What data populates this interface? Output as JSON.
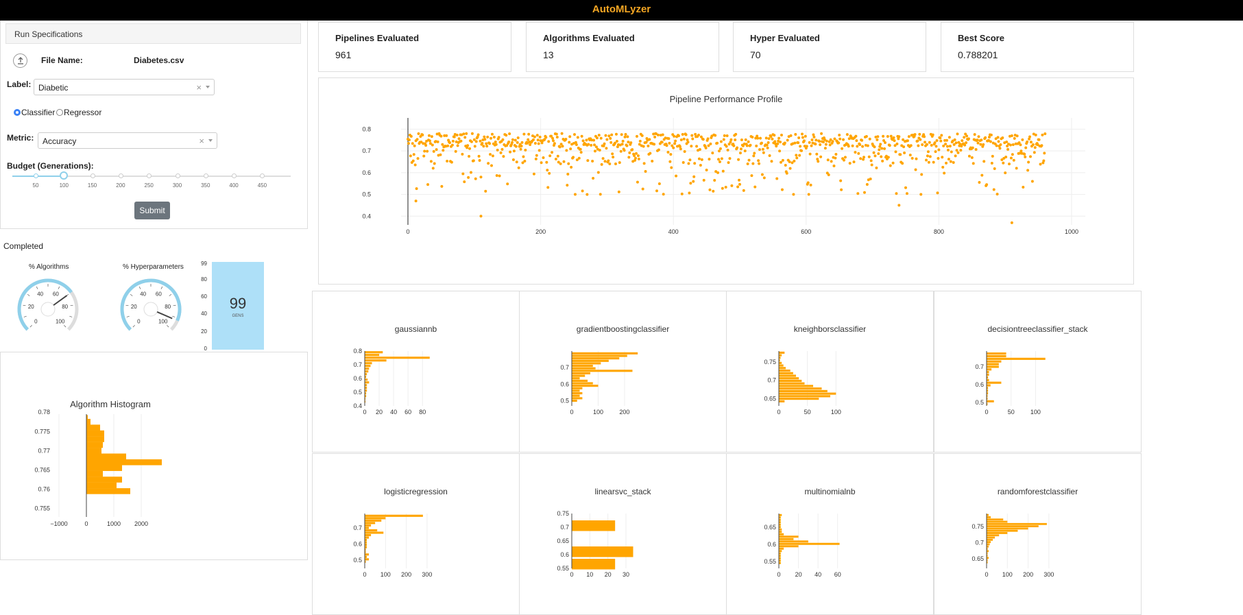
{
  "app": {
    "title": "AutoMLyzer"
  },
  "run_spec": {
    "header": "Run Specifications",
    "file_name_label": "File Name:",
    "file_name": "Diabetes.csv",
    "label_label": "Label:",
    "label_value": "Diabetic",
    "mode_options": [
      "Classifier",
      "Regressor"
    ],
    "mode_selected": "Classifier",
    "metric_label": "Metric:",
    "metric_value": "Accuracy",
    "budget_label": "Budget (Generations):",
    "budget_ticks": [
      "50",
      "100",
      "150",
      "200",
      "250",
      "300",
      "350",
      "400",
      "450"
    ],
    "budget_value": 100,
    "submit_label": "Submit"
  },
  "status": {
    "text": "Completed",
    "algorithms_gauge": {
      "title": "% Algorithms",
      "ticks": [
        "0",
        "20",
        "40",
        "60",
        "80",
        "100"
      ],
      "value": 70
    },
    "hyper_gauge": {
      "title": "% Hyperparameters",
      "ticks": [
        "0",
        "20",
        "40",
        "60",
        "80",
        "100"
      ],
      "value": 92
    },
    "progress": {
      "value": "99",
      "unit": "GENS",
      "axis": [
        "99",
        "80",
        "60",
        "40",
        "20",
        "0"
      ],
      "fill_fraction": 1.0
    }
  },
  "kpis": [
    {
      "title": "Pipelines Evaluated",
      "value": "961"
    },
    {
      "title": "Algorithms Evaluated",
      "value": "13"
    },
    {
      "title": "Hyper Evaluated",
      "value": "70"
    },
    {
      "title": "Best Score",
      "value": "0.788201"
    }
  ],
  "colors": {
    "accent": "#FFA500",
    "brand": "#f5a623",
    "progress": "#aee0f8",
    "gauge": "#8fd0ea"
  },
  "chart_data": [
    {
      "type": "scatter",
      "title": "Pipeline Performance Profile",
      "xlim": [
        0,
        1000
      ],
      "ylim": [
        0.36,
        0.82
      ],
      "xticks": [
        "0",
        "200",
        "400",
        "600",
        "800",
        "1000"
      ],
      "yticks": [
        "0.4",
        "0.5",
        "0.6",
        "0.7",
        "0.8"
      ],
      "n_points": 961,
      "outliers": [
        {
          "x": 12,
          "y": 0.47
        },
        {
          "x": 110,
          "y": 0.4
        },
        {
          "x": 910,
          "y": 0.37
        },
        {
          "x": 740,
          "y": 0.45
        },
        {
          "x": 270,
          "y": 0.5
        }
      ]
    },
    {
      "type": "bar",
      "orientation": "horizontal",
      "title": "Algorithm Histogram",
      "xlim": [
        -1000,
        3000
      ],
      "xticks": [
        "−1000",
        "0",
        "1000",
        "2000"
      ],
      "yticks": [
        "0.78",
        "0.775",
        "0.77",
        "0.765",
        "0.76",
        "0.755"
      ],
      "bins": [
        0.7785,
        0.7775,
        0.776,
        0.7745,
        0.773,
        0.7715,
        0.77,
        0.7685,
        0.767,
        0.7655,
        0.764,
        0.7625,
        0.761,
        0.7595,
        0.758,
        0.7565,
        0.755,
        0.7535
      ],
      "values": [
        50,
        150,
        500,
        650,
        650,
        600,
        550,
        1450,
        2750,
        1300,
        600,
        1300,
        1100,
        1600,
        0,
        0,
        0,
        0
      ]
    },
    {
      "type": "bar",
      "orientation": "horizontal",
      "title": "gaussiannb",
      "ylim": [
        0.4,
        0.8
      ],
      "yticks": [
        "0.8",
        "0.7",
        "0.6",
        "0.5",
        "0.4"
      ],
      "xlim": [
        0,
        95
      ],
      "xticks": [
        "0",
        "20",
        "40",
        "60",
        "80"
      ],
      "bins": [
        0.79,
        0.77,
        0.75,
        0.73,
        0.71,
        0.69,
        0.67,
        0.65,
        0.63,
        0.61,
        0.59,
        0.57,
        0.55,
        0.53,
        0.51,
        0.49,
        0.47,
        0.45,
        0.43,
        0.41
      ],
      "values": [
        25,
        20,
        90,
        30,
        10,
        8,
        6,
        5,
        3,
        2,
        4,
        6,
        3,
        3,
        3,
        2,
        2,
        1,
        1,
        0
      ]
    },
    {
      "type": "bar",
      "orientation": "horizontal",
      "title": "gradientboostingclassifier",
      "ylim": [
        0.47,
        0.8
      ],
      "yticks": [
        "0.7",
        "0.6",
        "0.5"
      ],
      "xlim": [
        0,
        260
      ],
      "xticks": [
        "0",
        "100",
        "200"
      ],
      "bins": [
        0.785,
        0.77,
        0.755,
        0.74,
        0.725,
        0.71,
        0.695,
        0.68,
        0.665,
        0.65,
        0.635,
        0.62,
        0.605,
        0.59,
        0.575,
        0.56,
        0.545,
        0.53,
        0.515,
        0.5
      ],
      "values": [
        250,
        210,
        180,
        140,
        110,
        80,
        90,
        230,
        70,
        50,
        30,
        60,
        80,
        100,
        40,
        30,
        40,
        30,
        40,
        20
      ]
    },
    {
      "type": "bar",
      "orientation": "horizontal",
      "title": "kneighborsclassifier",
      "ylim": [
        0.63,
        0.78
      ],
      "yticks": [
        "0.75",
        "0.7",
        "0.65"
      ],
      "xlim": [
        0,
        120
      ],
      "xticks": [
        "0",
        "50",
        "100"
      ],
      "bins": [
        0.775,
        0.768,
        0.761,
        0.754,
        0.747,
        0.74,
        0.733,
        0.726,
        0.719,
        0.712,
        0.705,
        0.698,
        0.691,
        0.684,
        0.677,
        0.67,
        0.663,
        0.656,
        0.649,
        0.642
      ],
      "values": [
        10,
        5,
        3,
        2,
        5,
        8,
        12,
        20,
        25,
        30,
        35,
        40,
        45,
        60,
        75,
        85,
        100,
        90,
        70,
        10
      ]
    },
    {
      "type": "bar",
      "orientation": "horizontal",
      "title": "decisiontreeclassifier_stack",
      "ylim": [
        0.48,
        0.79
      ],
      "yticks": [
        "0.7",
        "0.6",
        "0.5"
      ],
      "xlim": [
        0,
        140
      ],
      "xticks": [
        "0",
        "50",
        "100"
      ],
      "bins": [
        0.775,
        0.76,
        0.745,
        0.73,
        0.715,
        0.7,
        0.685,
        0.67,
        0.655,
        0.64,
        0.625,
        0.61,
        0.595,
        0.58,
        0.565,
        0.55,
        0.535,
        0.52,
        0.505,
        0.49
      ],
      "values": [
        40,
        40,
        120,
        30,
        25,
        25,
        10,
        5,
        5,
        3,
        5,
        30,
        8,
        3,
        3,
        3,
        2,
        2,
        15,
        2
      ]
    },
    {
      "type": "bar",
      "orientation": "horizontal",
      "title": "logisticregression",
      "ylim": [
        0.45,
        0.79
      ],
      "yticks": [
        "0.7",
        "0.6",
        "0.5"
      ],
      "xlim": [
        0,
        330
      ],
      "xticks": [
        "0",
        "100",
        "200",
        "300"
      ],
      "bins": [
        0.775,
        0.76,
        0.745,
        0.73,
        0.715,
        0.7,
        0.685,
        0.67,
        0.655,
        0.64,
        0.625,
        0.61,
        0.595,
        0.58,
        0.565,
        0.55,
        0.535,
        0.52,
        0.505,
        0.49
      ],
      "values": [
        280,
        100,
        80,
        50,
        30,
        20,
        60,
        90,
        30,
        20,
        10,
        10,
        10,
        10,
        5,
        5,
        20,
        10,
        20,
        5
      ]
    },
    {
      "type": "bar",
      "orientation": "horizontal",
      "title": "linearsvc_stack",
      "ylim": [
        0.55,
        0.75
      ],
      "yticks": [
        "0.75",
        "0.7",
        "0.65",
        "0.6",
        "0.55"
      ],
      "xlim": [
        0,
        38
      ],
      "xticks": [
        "0",
        "10",
        "20",
        "30"
      ],
      "bins": [
        0.705,
        0.61,
        0.565
      ],
      "values": [
        24,
        34,
        24
      ]
    },
    {
      "type": "bar",
      "orientation": "horizontal",
      "title": "multinomialnb",
      "ylim": [
        0.53,
        0.69
      ],
      "yticks": [
        "0.65",
        "0.6",
        "0.55"
      ],
      "xlim": [
        0,
        70
      ],
      "xticks": [
        "0",
        "20",
        "40",
        "60"
      ],
      "bins": [
        0.685,
        0.678,
        0.671,
        0.664,
        0.657,
        0.65,
        0.643,
        0.636,
        0.629,
        0.622,
        0.615,
        0.608,
        0.601,
        0.594,
        0.587,
        0.58,
        0.573,
        0.566,
        0.559,
        0.552,
        0.545
      ],
      "values": [
        3,
        2,
        2,
        2,
        2,
        2,
        3,
        3,
        5,
        20,
        15,
        30,
        62,
        20,
        5,
        3,
        2,
        2,
        2,
        2,
        2
      ]
    },
    {
      "type": "bar",
      "orientation": "horizontal",
      "title": "randomforestclassifier",
      "ylim": [
        0.62,
        0.79
      ],
      "yticks": [
        "0.75",
        "0.7",
        "0.65"
      ],
      "xlim": [
        0,
        330
      ],
      "xticks": [
        "0",
        "100",
        "200",
        "300"
      ],
      "bins": [
        0.785,
        0.778,
        0.771,
        0.764,
        0.757,
        0.75,
        0.743,
        0.736,
        0.729,
        0.722,
        0.715,
        0.708,
        0.701,
        0.694,
        0.687,
        0.68,
        0.673,
        0.666,
        0.659,
        0.652,
        0.645,
        0.638
      ],
      "values": [
        10,
        20,
        80,
        100,
        290,
        250,
        200,
        150,
        100,
        60,
        40,
        30,
        20,
        15,
        10,
        5,
        10,
        5,
        5,
        10,
        5,
        5
      ]
    }
  ]
}
